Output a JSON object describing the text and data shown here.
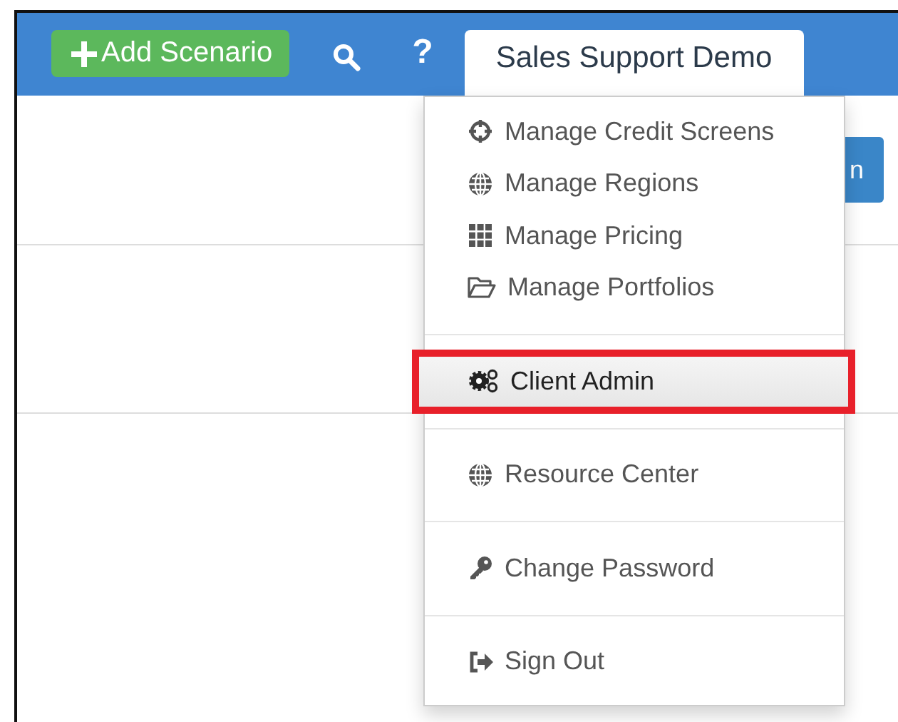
{
  "navbar": {
    "add_button": {
      "kind": "plus",
      "label": "Add Scenario"
    },
    "icons": [
      {
        "kind": "search"
      },
      {
        "kind": "help",
        "label": "?"
      }
    ],
    "account_tab": {
      "label": "Sales Support Demo",
      "expanded": true
    }
  },
  "page": {
    "button": {
      "label": "n"
    }
  },
  "dropdown": {
    "groups": [
      {
        "items": [
          {
            "kind": "crosshair",
            "label": "Manage Credit Screens",
            "selected": false,
            "annotated": false
          },
          {
            "kind": "globe",
            "label": "Manage Regions",
            "selected": false,
            "annotated": false
          },
          {
            "kind": "grid",
            "label": "Manage Pricing",
            "selected": false,
            "annotated": false
          },
          {
            "kind": "folder",
            "label": "Manage Portfolios",
            "selected": false,
            "annotated": false
          }
        ]
      },
      {
        "items": [
          {
            "kind": "gears",
            "label": "Client Admin",
            "selected": true,
            "annotated": true
          }
        ]
      },
      {
        "items": [
          {
            "kind": "globe",
            "label": "Resource Center",
            "selected": false,
            "annotated": false
          }
        ]
      },
      {
        "items": [
          {
            "kind": "key",
            "label": "Change Password",
            "selected": false,
            "annotated": false
          }
        ]
      },
      {
        "items": [
          {
            "kind": "signout",
            "label": "Sign Out",
            "selected": false,
            "annotated": false
          }
        ]
      }
    ]
  }
}
